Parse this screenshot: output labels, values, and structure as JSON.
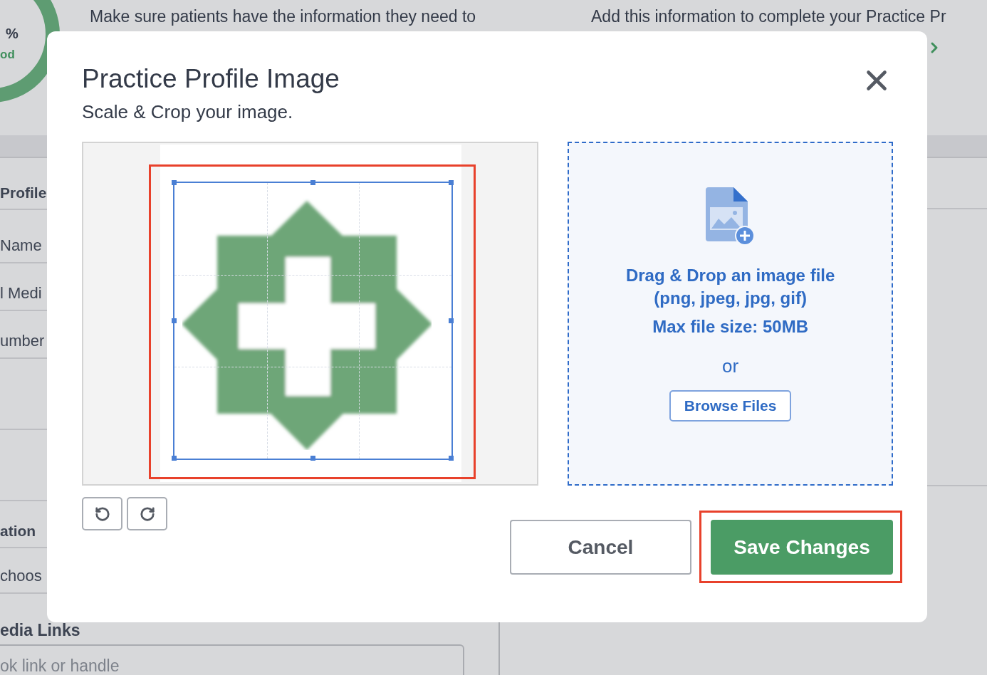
{
  "background": {
    "progress": {
      "percent": "%",
      "rating": "od"
    },
    "intro_texts": [
      "Make sure patients have the information they need to",
      "Add this information to complete your Practice Pr"
    ],
    "profile_rows": [
      {
        "label": "Profile",
        "kind": "heading"
      },
      {
        "label": "Name",
        "kind": "label"
      },
      {
        "label": "l Medi",
        "kind": "value"
      },
      {
        "label": "umber",
        "kind": "label"
      }
    ],
    "location_rows": [
      {
        "label": "ation",
        "kind": "heading"
      },
      {
        "label": "choos",
        "kind": "value"
      }
    ],
    "social_heading": "edia Links",
    "social_field": {
      "placeholder": "ok link or handle"
    }
  },
  "dialog": {
    "title": "Practice Profile Image",
    "subtitle": "Scale & Crop your image.",
    "crop": {
      "highlighted": true
    },
    "dropzone": {
      "lines": [
        "Drag & Drop an image file",
        "(png, jpeg, jpg, gif)",
        "Max file size: 50MB"
      ],
      "separator": "or",
      "browse_button": "Browse Files"
    },
    "buttons": [
      {
        "label": "Cancel",
        "kind": "secondary",
        "highlighted": false
      },
      {
        "label": "Save Changes",
        "kind": "primary",
        "highlighted": true
      }
    ]
  }
}
